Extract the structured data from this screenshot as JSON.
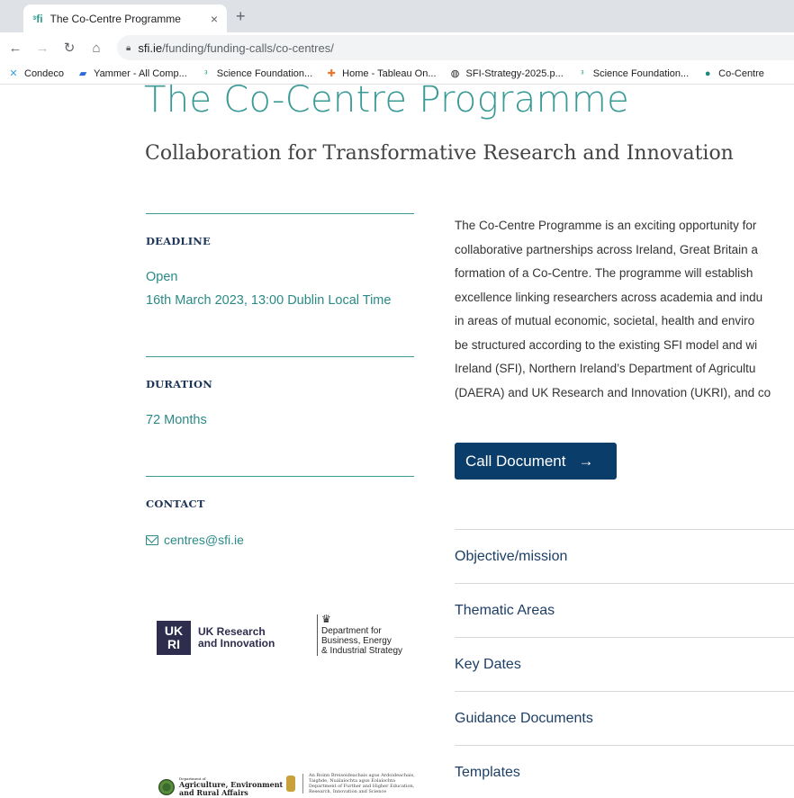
{
  "browser": {
    "tab_title": "The Co-Centre Programme",
    "tab_close": "×",
    "new_tab": "+",
    "url_host": "sfi.ie",
    "url_path": "/funding/funding-calls/co-centres/",
    "bookmarks": [
      {
        "label": "Condeco",
        "icon": "condeco-icon",
        "color": "#3aa0d8"
      },
      {
        "label": "Yammer - All Comp...",
        "icon": "yammer-icon",
        "color": "#2e6bd6"
      },
      {
        "label": "Science Foundation...",
        "icon": "sfi-icon",
        "color": "#2a9d8f"
      },
      {
        "label": "Home - Tableau On...",
        "icon": "tableau-icon",
        "color": "#e8762d"
      },
      {
        "label": "SFI-Strategy-2025.p...",
        "icon": "globe-icon",
        "color": "#202124"
      },
      {
        "label": "Science Foundation...",
        "icon": "sfi-icon",
        "color": "#2a9d8f"
      },
      {
        "label": "Co-Centre",
        "icon": "co-centre-icon",
        "color": "#1f8a7a"
      }
    ]
  },
  "page": {
    "title": "The Co-Centre Programme",
    "subtitle": "Collaboration for Transformative Research and Innovation",
    "deadline_label": "DEADLINE",
    "deadline_status": "Open",
    "deadline_date": "16th March 2023, 13:00 Dublin Local Time",
    "duration_label": "DURATION",
    "duration_value": "72 Months",
    "contact_label": "CONTACT",
    "contact_email": "centres@sfi.ie",
    "description_lines": [
      "The Co-Centre Programme is an exciting opportunity for",
      "collaborative partnerships across Ireland, Great Britain a",
      "formation of a Co-Centre. The programme will establish",
      "excellence linking researchers across academia and indu",
      "in areas of mutual economic, societal, health and enviro",
      "be structured according to the existing SFI model and wi",
      "Ireland (SFI), Northern Ireland’s Department of Agricultu",
      "(DAERA) and UK Research and Innovation (UKRI), and co"
    ],
    "call_document": "Call Document",
    "accordion": [
      "Objective/mission",
      "Thematic Areas",
      "Key Dates",
      "Guidance Documents",
      "Templates"
    ]
  },
  "logos": {
    "ukri_mark_top": "UK",
    "ukri_mark_bottom": "RI",
    "ukri_line1": "UK Research",
    "ukri_line2": "and Innovation",
    "beis_line1": "Department for",
    "beis_line2": "Business, Energy",
    "beis_line3": "& Industrial Strategy",
    "daera_small": "Department of",
    "daera_line1": "Agriculture, Environment",
    "daera_line2": "and Rural Affairs",
    "dfhe_line1": "An Roinn Breisoideachais agus Ardoideachais,",
    "dfhe_line2": "Taighde, Nuálaíochta agus Eolaíochta",
    "dfhe_line3": "Department of Further and Higher Education,",
    "dfhe_line4": "Research, Innovation and Science"
  }
}
